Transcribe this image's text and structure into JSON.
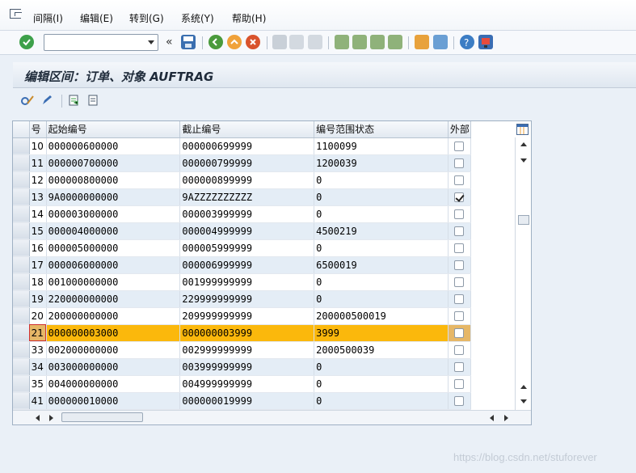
{
  "menu": {
    "items": [
      "间隔(I)",
      "编辑(E)",
      "转到(G)",
      "系统(Y)",
      "帮助(H)"
    ]
  },
  "toolbar": {
    "command_value": "",
    "back_glyph": "«"
  },
  "title": "编辑区间：订单、对象 AUFTRAG",
  "table": {
    "headers": [
      "号",
      "起始编号",
      "截止编号",
      "编号范围状态",
      "外部"
    ],
    "rows": [
      {
        "no": "10",
        "from": "000000600000",
        "to": "000000699999",
        "status": "1100099",
        "ext": false
      },
      {
        "no": "11",
        "from": "000000700000",
        "to": "000000799999",
        "status": "1200039",
        "ext": false
      },
      {
        "no": "12",
        "from": "000000800000",
        "to": "000000899999",
        "status": "0",
        "ext": false
      },
      {
        "no": "13",
        "from": "9A0000000000",
        "to": "9AZZZZZZZZZZ",
        "status": "0",
        "ext": true
      },
      {
        "no": "14",
        "from": "000003000000",
        "to": "000003999999",
        "status": "0",
        "ext": false
      },
      {
        "no": "15",
        "from": "000004000000",
        "to": "000004999999",
        "status": "4500219",
        "ext": false
      },
      {
        "no": "16",
        "from": "000005000000",
        "to": "000005999999",
        "status": "0",
        "ext": false
      },
      {
        "no": "17",
        "from": "000006000000",
        "to": "000006999999",
        "status": "6500019",
        "ext": false
      },
      {
        "no": "18",
        "from": "001000000000",
        "to": "001999999999",
        "status": "0",
        "ext": false
      },
      {
        "no": "19",
        "from": "220000000000",
        "to": "229999999999",
        "status": "0",
        "ext": false
      },
      {
        "no": "20",
        "from": "200000000000",
        "to": "209999999999",
        "status": "200000500019",
        "ext": false
      },
      {
        "no": "21",
        "from": "000000003000",
        "to": "000000003999",
        "status": "3999",
        "ext": false
      },
      {
        "no": "33",
        "from": "002000000000",
        "to": "002999999999",
        "status": "2000500039",
        "ext": false
      },
      {
        "no": "34",
        "from": "003000000000",
        "to": "003999999999",
        "status": "0",
        "ext": false
      },
      {
        "no": "35",
        "from": "004000000000",
        "to": "004999999999",
        "status": "0",
        "ext": false
      },
      {
        "no": "41",
        "from": "000000010000",
        "to": "000000019999",
        "status": "0",
        "ext": false
      }
    ],
    "highlighted_row": "21"
  },
  "watermark": "https://blog.csdn.net/stuforever",
  "colors": {
    "highlight": "#fbb80c",
    "accent": "#2f6db3"
  }
}
